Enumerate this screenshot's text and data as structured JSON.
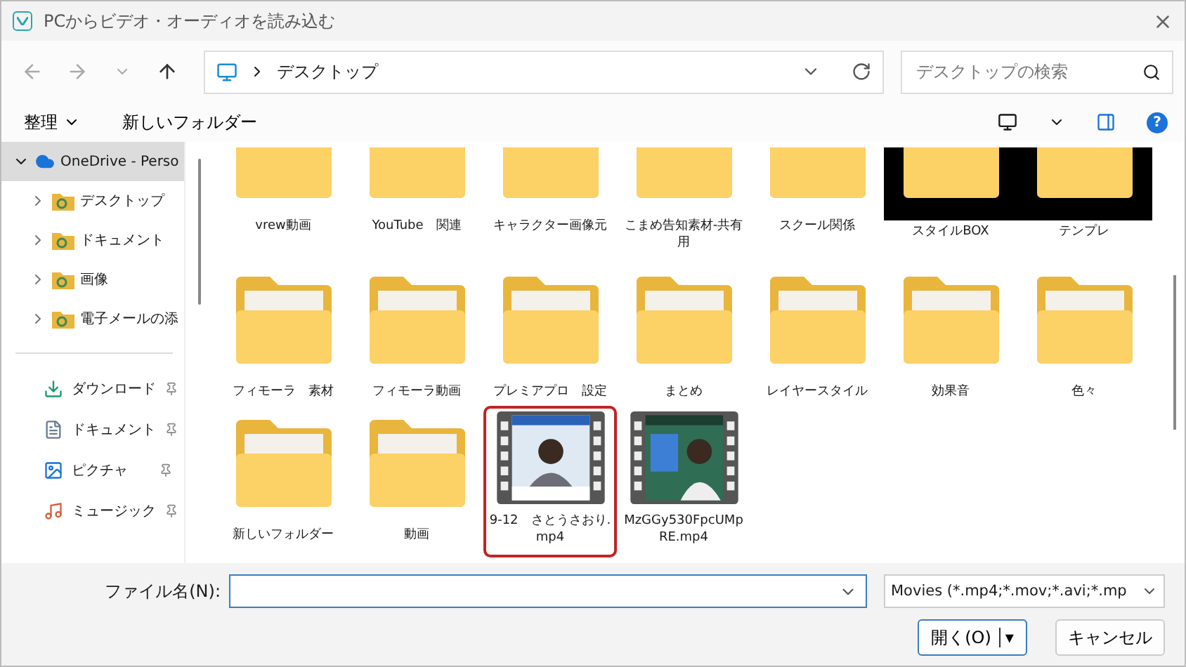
{
  "window": {
    "title": "PCからビデオ・オーディオを読み込む"
  },
  "address": {
    "path": "デスクトップ"
  },
  "search": {
    "placeholder": "デスクトップの検索"
  },
  "command_bar": {
    "organize": "整理",
    "new_folder": "新しいフォルダー"
  },
  "sidebar": {
    "items": [
      {
        "label": "OneDrive - Perso",
        "selected": true,
        "expanded": true,
        "children": [
          {
            "label": "デスクトップ",
            "expanded": false
          },
          {
            "label": "ドキュメント",
            "expanded": false
          },
          {
            "label": "画像",
            "expanded": false
          },
          {
            "label": "電子メールの添",
            "expanded": false
          }
        ]
      }
    ],
    "quick_access": [
      {
        "label": "ダウンロード",
        "kind": "download",
        "pinned": true
      },
      {
        "label": "ドキュメント",
        "kind": "document",
        "pinned": true
      },
      {
        "label": "ピクチャ",
        "kind": "pictures",
        "pinned": true
      },
      {
        "label": "ミュージック",
        "kind": "music",
        "pinned": true
      }
    ]
  },
  "files": [
    {
      "name": "vrew動画",
      "kind": "folder",
      "cut": true,
      "selected": false
    },
    {
      "name": "YouTube　関連",
      "kind": "folder",
      "cut": true,
      "selected": false
    },
    {
      "name": "キャラクター画像元",
      "kind": "folder",
      "cut": true,
      "selected": false
    },
    {
      "name": "こまめ告知素材-共有用",
      "kind": "folder",
      "cut": true,
      "selected": false
    },
    {
      "name": "スクール関係",
      "kind": "folder",
      "cut": true,
      "selected": false
    },
    {
      "name": "スタイルBOX",
      "kind": "dark",
      "cut": true,
      "selected": false
    },
    {
      "name": "テンプレ",
      "kind": "dark",
      "cut": true,
      "selected": false
    },
    {
      "name": "フィモーラ　素材",
      "kind": "folder",
      "cut": false,
      "selected": false
    },
    {
      "name": "フィモーラ動画",
      "kind": "folder",
      "cut": false,
      "selected": false
    },
    {
      "name": "プレミアプロ　設定",
      "kind": "folder",
      "cut": false,
      "selected": false
    },
    {
      "name": "まとめ",
      "kind": "folder",
      "cut": false,
      "selected": false
    },
    {
      "name": "レイヤースタイル",
      "kind": "folder",
      "cut": false,
      "selected": false
    },
    {
      "name": "効果音",
      "kind": "folder",
      "cut": false,
      "selected": false
    },
    {
      "name": "色々",
      "kind": "folder",
      "cut": false,
      "selected": false
    },
    {
      "name": "新しいフォルダー",
      "kind": "folder",
      "cut": false,
      "selected": false
    },
    {
      "name": "動画",
      "kind": "folder",
      "cut": false,
      "selected": false
    },
    {
      "name": "9-12　さとうさおり.mp4",
      "kind": "video",
      "selected": true
    },
    {
      "name": "MzGGy530FpcUMpRE.mp4",
      "kind": "video",
      "selected": false
    }
  ],
  "help": "?",
  "footer": {
    "filename_label": "ファイル名(N):",
    "file_type": "Movies (*.mp4;*.mov;*.avi;*.mp",
    "open": "開く(O)",
    "open_caret": "▾",
    "cancel": "キャンセル"
  }
}
